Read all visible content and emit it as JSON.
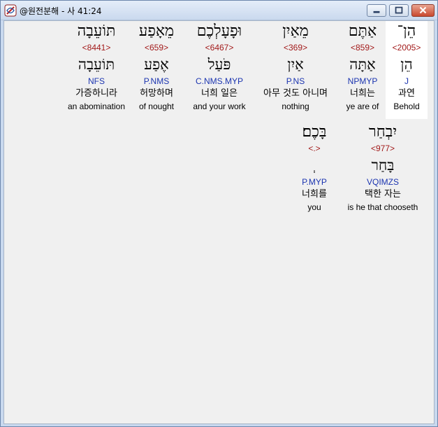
{
  "window": {
    "title": "@원전분해 - 사 41:24",
    "min_icon": "minimize-icon",
    "max_icon": "maximize-icon",
    "close_icon": "close-icon"
  },
  "words": [
    {
      "heb": "הֵן־",
      "strong": "<2005>",
      "lemma": "הֵן",
      "morph": "J",
      "kor": "과연",
      "eng": "Behold",
      "highlight": true
    },
    {
      "heb": "אַתֶּם",
      "strong": "<859>",
      "lemma": "אַתָּה",
      "morph": "NPMYP",
      "kor": "너희는",
      "eng": "ye are of"
    },
    {
      "heb": "מֵאַיִן",
      "strong": "<369>",
      "lemma": "אַיִן",
      "morph": "P.NS",
      "kor": "아무 것도 아니며",
      "eng": "nothing"
    },
    {
      "heb": "וּפָעָלְכֶם",
      "strong": "<6467>",
      "lemma": "פֹּעַל",
      "morph": "C.NMS.MYP",
      "kor": "너희 일은",
      "eng": "and your work"
    },
    {
      "heb": "מֵאָפַע",
      "strong": "<659>",
      "lemma": "אֶפַע",
      "morph": "P.NMS",
      "kor": "허망하며",
      "eng": "of nought"
    },
    {
      "heb": "תּוֹעֵבָה",
      "strong": "<8441>",
      "lemma": "תּוֹעֵבָה",
      "morph": "NFS",
      "kor": "가증하니라",
      "eng": "an abomination"
    },
    {
      "heb": "יִבְחַר",
      "strong": "<977>",
      "lemma": "בָּחַר",
      "morph": "VQIMZS",
      "kor": "택한 자는",
      "eng": "is he that chooseth"
    },
    {
      "heb": "בָּכֶם׃",
      "strong": "<.>",
      "lemma": "ְ",
      "morph": "P.MYP",
      "kor": "너희를",
      "eng": "you"
    }
  ]
}
